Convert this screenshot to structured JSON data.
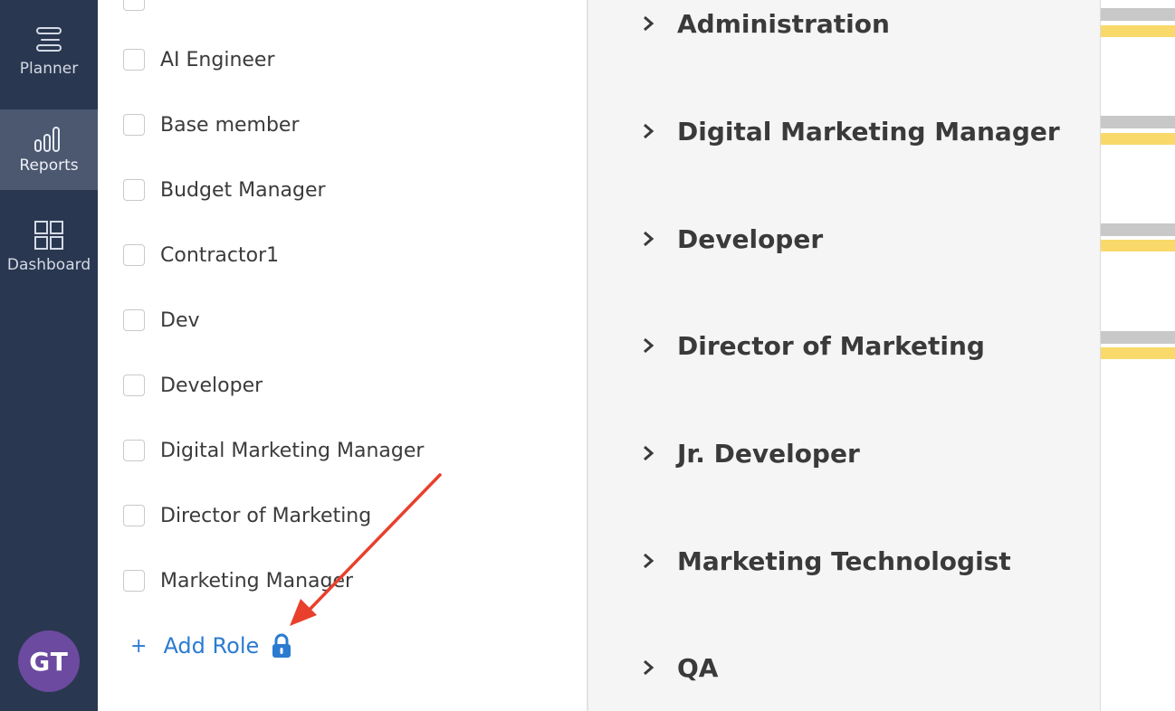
{
  "nav": {
    "items": [
      {
        "label": "Planner",
        "icon": "planner-icon"
      },
      {
        "label": "Reports",
        "icon": "reports-icon"
      },
      {
        "label": "Dashboard",
        "icon": "dashboard-icon"
      }
    ],
    "avatar_initials": "GT"
  },
  "roles_panel": {
    "items": [
      {
        "label": "AI Engineer",
        "checked": false
      },
      {
        "label": "Base member",
        "checked": false
      },
      {
        "label": "Budget Manager",
        "checked": false
      },
      {
        "label": "Contractor1",
        "checked": false
      },
      {
        "label": "Dev",
        "checked": false
      },
      {
        "label": "Developer",
        "checked": false
      },
      {
        "label": "Digital Marketing Manager",
        "checked": false
      },
      {
        "label": "Director of Marketing",
        "checked": false
      },
      {
        "label": "Marketing Manager",
        "checked": false
      }
    ],
    "add_role_label": "Add Role",
    "add_role_icon": "lock-icon"
  },
  "groups": {
    "items": [
      {
        "label": "Administration"
      },
      {
        "label": "Digital Marketing Manager"
      },
      {
        "label": "Developer"
      },
      {
        "label": "Director of Marketing"
      },
      {
        "label": "Jr. Developer"
      },
      {
        "label": "Marketing Technologist"
      },
      {
        "label": "QA"
      }
    ]
  },
  "colors": {
    "nav_bg": "#2a3750",
    "nav_active": "#4b5870",
    "accent_blue": "#2b7bd1",
    "avatar": "#6b4aa0",
    "annotation_arrow": "#e8402c",
    "bar_yellow": "#f8d96a",
    "bar_gray": "#c8c8c8"
  }
}
